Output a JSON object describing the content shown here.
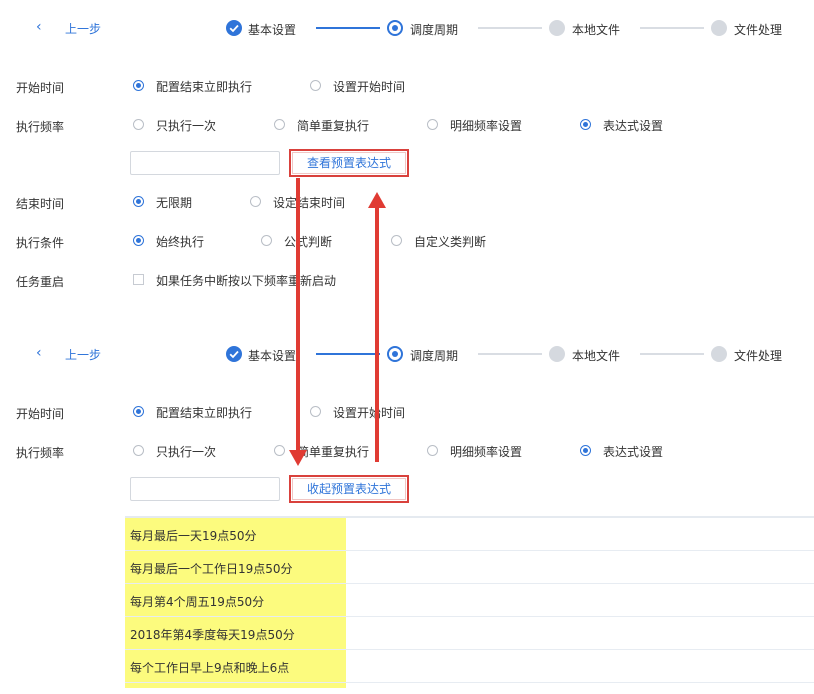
{
  "panel_collapsed": {
    "back": {
      "label": "上一步"
    },
    "steps": [
      {
        "label": "基本设置",
        "state": "done"
      },
      {
        "label": "调度周期",
        "state": "current"
      },
      {
        "label": "本地文件",
        "state": "todo"
      },
      {
        "label": "文件处理",
        "state": "todo"
      }
    ],
    "start_time": {
      "label": "开始时间",
      "options": [
        "配置结束立即执行",
        "设置开始时间"
      ],
      "selected": "配置结束立即执行"
    },
    "frequency": {
      "label": "执行频率",
      "options": [
        "只执行一次",
        "简单重复执行",
        "明细频率设置",
        "表达式设置"
      ],
      "selected": "表达式设置"
    },
    "expression_input": {
      "value": ""
    },
    "toggle_button": {
      "label": "查看预置表达式"
    },
    "end_time": {
      "label": "结束时间",
      "options": [
        "无限期",
        "设定结束时间"
      ],
      "selected": "无限期"
    },
    "condition": {
      "label": "执行条件",
      "options": [
        "始终执行",
        "公式判断",
        "自定义类判断"
      ],
      "selected": "始终执行"
    },
    "restart": {
      "label": "任务重启",
      "checkbox_label": "如果任务中断按以下频率重新启动",
      "checked": false
    }
  },
  "panel_expanded": {
    "back": {
      "label": "上一步"
    },
    "steps": [
      {
        "label": "基本设置",
        "state": "done"
      },
      {
        "label": "调度周期",
        "state": "current"
      },
      {
        "label": "本地文件",
        "state": "todo"
      },
      {
        "label": "文件处理",
        "state": "todo"
      }
    ],
    "start_time": {
      "label": "开始时间",
      "options": [
        "配置结束立即执行",
        "设置开始时间"
      ],
      "selected": "配置结束立即执行"
    },
    "frequency": {
      "label": "执行频率",
      "options": [
        "只执行一次",
        "简单重复执行",
        "明细频率设置",
        "表达式设置"
      ],
      "selected": "表达式设置"
    },
    "expression_input": {
      "value": ""
    },
    "toggle_button": {
      "label": "收起预置表达式"
    },
    "presets": [
      "每月最后一天19点50分",
      "每月最后一个工作日19点50分",
      "每月第4个周五19点50分",
      "2018年第4季度每天19点50分",
      "每个工作日早上9点和晚上6点"
    ]
  },
  "colors": {
    "accent": "#2f74d9",
    "annotation_red": "#d9413c",
    "highlight_yellow": "#fcfb7e"
  }
}
